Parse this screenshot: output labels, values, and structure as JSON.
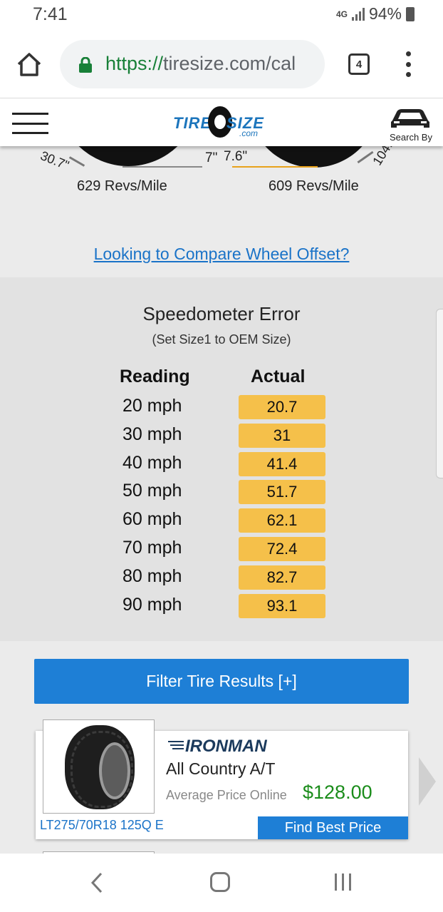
{
  "status_bar": {
    "time": "7:41",
    "network": "4G",
    "battery": "94%"
  },
  "browser": {
    "url_scheme": "https://",
    "url_host": "tiresize.com/cal",
    "tab_count": "4"
  },
  "site_header": {
    "logo_tire": "TIRE",
    "logo_size": "SIZE",
    "logo_com": ".com",
    "search_by_label": "Search By"
  },
  "tire_compare": {
    "left_diameter": "30.7\"",
    "right_diameter": "104.",
    "left_width": "7\"",
    "right_width": "7.6\"",
    "left_revs": "629 Revs/Mile",
    "right_revs": "609 Revs/Mile",
    "offset_link": "Looking to Compare Wheel Offset?"
  },
  "speedometer": {
    "title": "Speedometer Error",
    "subtitle": "(Set Size1 to OEM Size)",
    "col_reading": "Reading",
    "col_actual": "Actual",
    "rows": [
      {
        "reading": "20 mph",
        "actual": "20.7"
      },
      {
        "reading": "30 mph",
        "actual": "31"
      },
      {
        "reading": "40 mph",
        "actual": "41.4"
      },
      {
        "reading": "50 mph",
        "actual": "51.7"
      },
      {
        "reading": "60 mph",
        "actual": "62.1"
      },
      {
        "reading": "70 mph",
        "actual": "72.4"
      },
      {
        "reading": "80 mph",
        "actual": "82.7"
      },
      {
        "reading": "90 mph",
        "actual": "93.1"
      }
    ],
    "highlight_color": "#f5c04a"
  },
  "results": {
    "filter_label": "Filter Tire Results [+]",
    "product": {
      "brand": "IRONMAN",
      "name": "All Country A/T",
      "price_label": "Average Price Online",
      "price": "$128.00",
      "size": "LT275/70R18 125Q E",
      "cta": "Find Best Price"
    }
  },
  "colors": {
    "link_blue": "#1a73c8",
    "button_blue": "#1e7fd6",
    "price_green": "#1a8c1a",
    "url_green": "#188038"
  }
}
